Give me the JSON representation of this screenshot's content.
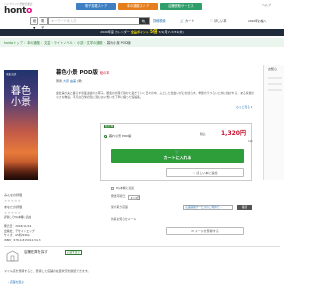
{
  "header": {
    "logo_tagline": "ハイブリッド型総合書店",
    "logo": {
      "main": "hont",
      "accent": "o"
    },
    "tabs": [
      {
        "label": "電子書籍ストア",
        "color": "#3d7fc1"
      },
      {
        "label": "本の通販ストア",
        "color": "#e57e1c"
      },
      {
        "label": "店舗受取サービス",
        "color": "#2f9e6a"
      }
    ],
    "help": "ヘルプ",
    "category_select": "紙 ▼",
    "scope_select": "電子 ▼",
    "search_placeholder": "キーワードを入力",
    "search_button": "🔍",
    "detail_search": "詳細検索",
    "cart_label": "カート",
    "want_label": "ほしい本",
    "account": "2020年お帳へ",
    "campaign": {
      "prefix": "2020年度 カレンダー",
      "highlight": "全品ポイント",
      "big": "5倍",
      "suffix": "7/1(月)〜7/31(木)"
    }
  },
  "breadcrumb": [
    "hontoトップ",
    "本の通販",
    "新刊・予約",
    "文芸・ライトノベル",
    "小説・文学の通販",
    "文芸・日本文学の通販",
    "暮れ小景 POD版"
  ],
  "product": {
    "cover_title": "暮色小景",
    "cover_author": "木蓮 由美",
    "title": "暮色小景 POD版",
    "format_badge": "紙の本",
    "byline_label": "著者",
    "author": "大原 由美",
    "author_role": "(著)",
    "description": "会社員の夫と暮らす専業主婦の沙耶子。都会の片隅で静かに過ぎていく日々の中、ふとした出会いが心を揺らす。季節のうつろいと共に描かれる、ある家族の小さな物語。平凡な日常の陰に潜む淡い想いを丁寧に綴った短編集。",
    "more_link": "もっと見る ▾",
    "rating_label": "みんなの評価",
    "my_rating_label": "あなたの評価",
    "my_rating_note": "評価してMy本棚に追加",
    "stars": "★★★★★",
    "meta": [
      "発売日：2018/11/19",
      "出版社：デザインエッグ",
      "サイズ：A5判/296p",
      "ISBN：978-4-815012-54-3"
    ]
  },
  "buybox": {
    "badge": "紙の本",
    "option_label": "暮れ小景 POD版",
    "price_prefix": "税込",
    "price": "1,320円",
    "points": "1pt",
    "cart_icon": "🛒",
    "cart_button": "カートに入れる",
    "wish_button": "♡ ほしい本に追加",
    "gift_note": "My本棚に追加",
    "stock_label": "発送可能日：",
    "stock_value": "1〜3日",
    "store_label": "受け取り店舗",
    "store_input": "店舗受取サービスのご利用で...",
    "calc_button": "確認",
    "notify_label": "新着お知らせメール",
    "mail_button": "✉ メールを登録する"
  },
  "side_panel": {
    "header": "お知ら"
  },
  "store_section": {
    "title": "店舗在庫を探す",
    "pill": "店舗を選ぶ",
    "note": "マイル店を登録すると、登録した店舗の在庫状況を確認できます。",
    "link": "› 店舗を選ぶ"
  }
}
